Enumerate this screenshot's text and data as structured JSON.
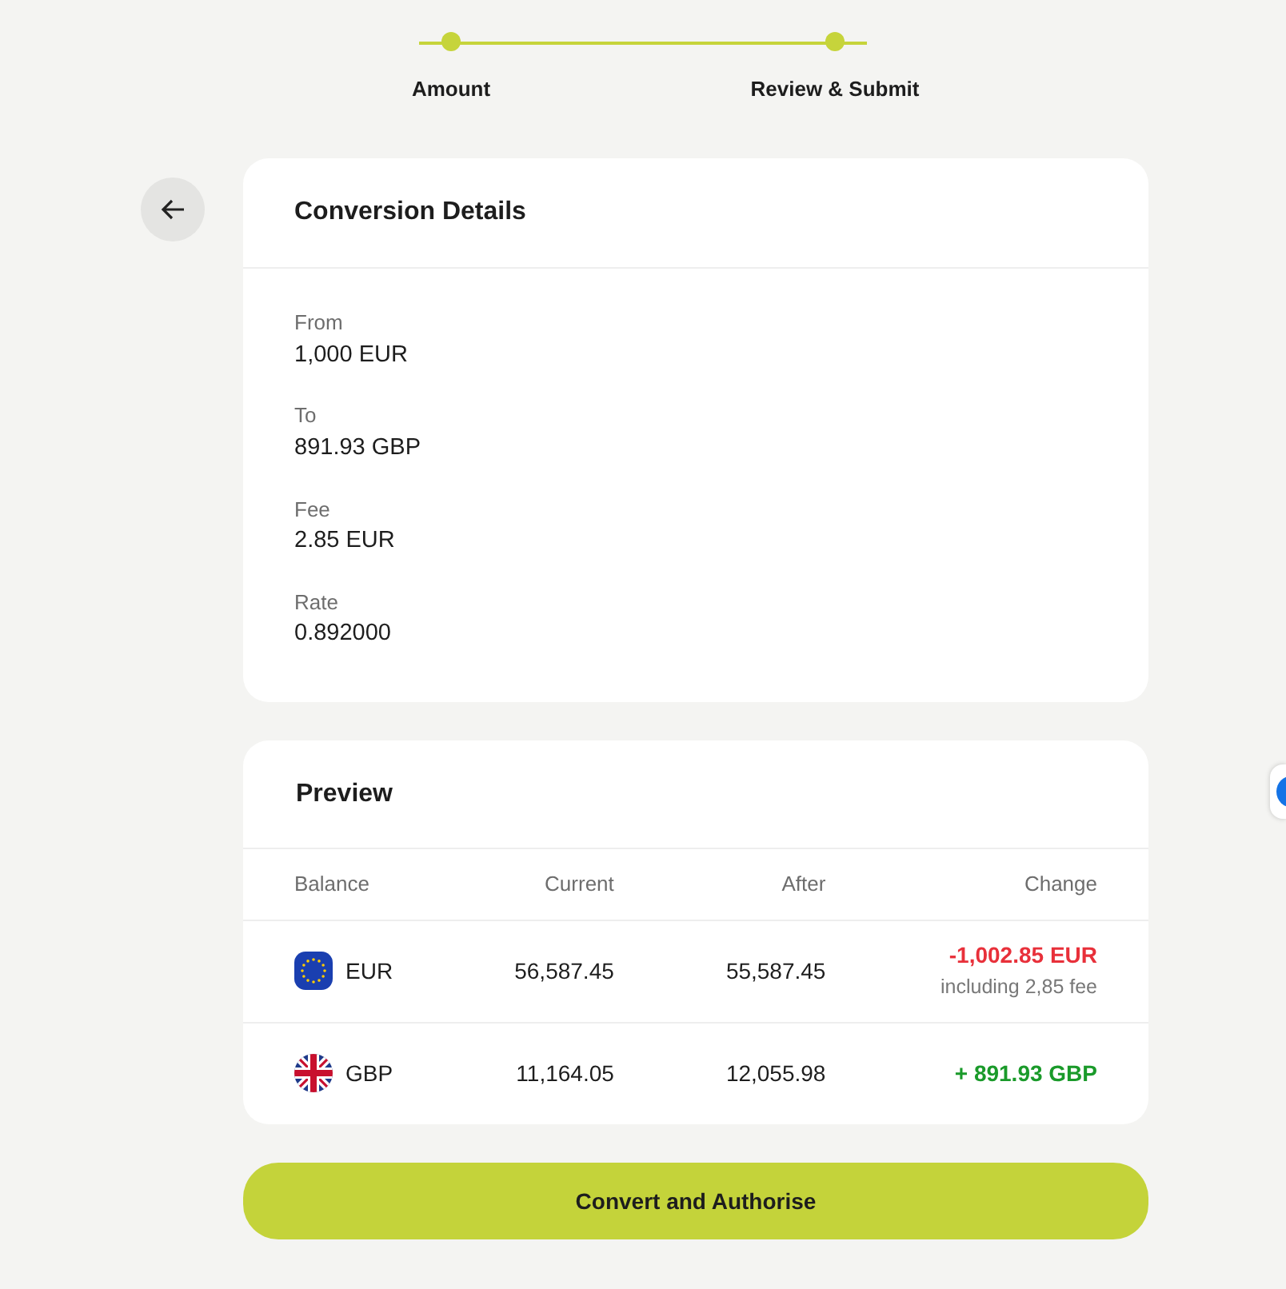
{
  "steps": [
    {
      "label": "Amount",
      "done": true
    },
    {
      "label": "Review & Submit",
      "done": true
    }
  ],
  "details": {
    "title": "Conversion Details",
    "fields": [
      {
        "label": "From",
        "value": "1,000 EUR"
      },
      {
        "label": "To",
        "value": "891.93 GBP"
      },
      {
        "label": "Fee",
        "value": "2.85 EUR"
      },
      {
        "label": "Rate",
        "value": "0.892000"
      }
    ]
  },
  "preview": {
    "title": "Preview",
    "columns": [
      "Balance",
      "Current",
      "After",
      "Change"
    ],
    "rows": [
      {
        "kind": "eu",
        "currency": "EUR",
        "current": "56,587.45",
        "after": "55,587.45",
        "change": "-1,002.85 EUR",
        "color": "#e8303a",
        "note": "including 2,85 fee"
      },
      {
        "kind": "uk",
        "currency": "GBP",
        "current": "11,164.05",
        "after": "12,055.98",
        "change": "+ 891.93 GBP",
        "color": "#1a9a2a"
      }
    ]
  },
  "submit": "Convert and Authorise"
}
